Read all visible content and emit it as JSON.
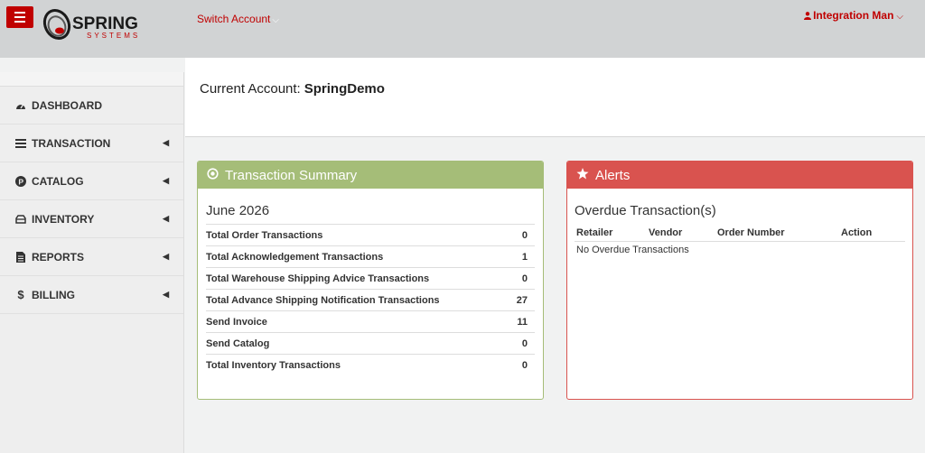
{
  "header": {
    "logo_text": "SPRING",
    "logo_sub": "SYSTEMS",
    "switch_account": "Switch Account",
    "user_name": "Integration Man"
  },
  "sidebar": {
    "items": [
      {
        "label": "DASHBOARD",
        "icon": "dashboard-icon",
        "has_arrow": false
      },
      {
        "label": "TRANSACTION",
        "icon": "transaction-icon",
        "has_arrow": true
      },
      {
        "label": "CATALOG",
        "icon": "catalog-icon",
        "has_arrow": true
      },
      {
        "label": "INVENTORY",
        "icon": "inventory-icon",
        "has_arrow": true
      },
      {
        "label": "REPORTS",
        "icon": "reports-icon",
        "has_arrow": true
      },
      {
        "label": "BILLING",
        "icon": "dollar-icon",
        "has_arrow": true
      }
    ]
  },
  "account": {
    "label": "Current Account:",
    "value": "SpringDemo"
  },
  "summary": {
    "title": "Transaction Summary",
    "month": "June 2026",
    "rows": [
      {
        "label": "Total Order Transactions",
        "value": "0"
      },
      {
        "label": "Total Acknowledgement Transactions",
        "value": "1"
      },
      {
        "label": "Total Warehouse Shipping Advice Transactions",
        "value": "0"
      },
      {
        "label": "Total Advance Shipping Notification Transactions",
        "value": "27"
      },
      {
        "label": "Send Invoice",
        "value": "11"
      },
      {
        "label": "Send Catalog",
        "value": "0"
      },
      {
        "label": "Total Inventory Transactions",
        "value": "0"
      }
    ]
  },
  "alerts": {
    "title": "Alerts",
    "subtitle": "Overdue Transaction(s)",
    "columns": [
      "Retailer",
      "Vendor",
      "Order Number",
      "Action"
    ],
    "empty_text": "No Overdue Transactions"
  },
  "colors": {
    "brand_red": "#c00000",
    "summary_green": "#a5bd78",
    "alerts_red": "#d9534f"
  }
}
